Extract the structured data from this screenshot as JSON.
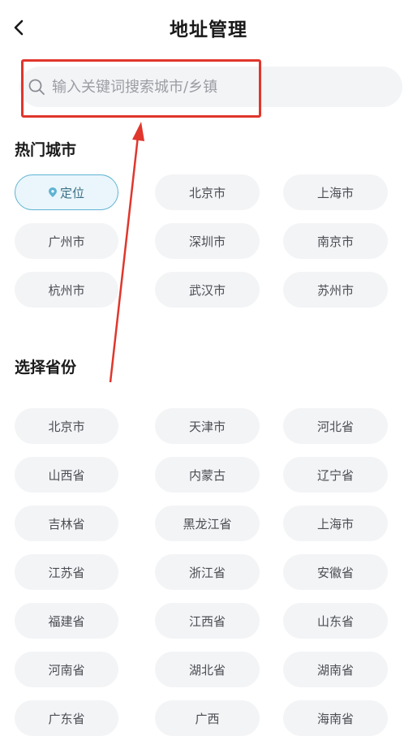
{
  "header": {
    "title": "地址管理"
  },
  "search": {
    "placeholder": "输入关键词搜索城市/乡镇",
    "value": ""
  },
  "hot_cities": {
    "title": "热门城市",
    "items": [
      "定位",
      "北京市",
      "上海市",
      "广州市",
      "深圳市",
      "南京市",
      "杭州市",
      "武汉市",
      "苏州市"
    ]
  },
  "provinces": {
    "title": "选择省份",
    "items": [
      "北京市",
      "天津市",
      "河北省",
      "山西省",
      "内蒙古",
      "辽宁省",
      "吉林省",
      "黑龙江省",
      "上海市",
      "江苏省",
      "浙江省",
      "安徽省",
      "福建省",
      "江西省",
      "山东省",
      "河南省",
      "湖北省",
      "湖南省",
      "广东省",
      "广西",
      "海南省"
    ]
  },
  "icons": {
    "back": "chevron-left-icon",
    "search": "search-icon",
    "locate": "location-pin-icon"
  },
  "colors": {
    "annotation": "#e0362c",
    "active_chip_border": "#5fb3d3",
    "chip_bg": "#f3f4f6"
  }
}
